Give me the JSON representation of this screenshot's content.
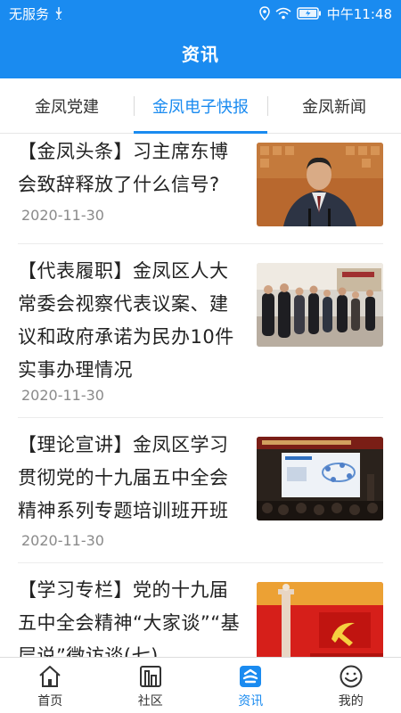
{
  "status_bar": {
    "carrier": "无服务",
    "usb_icon": "usb-icon",
    "location_icon": "location-icon",
    "wifi_icon": "wifi-icon",
    "battery_icon": "battery-charging-icon",
    "time": "中午11:48"
  },
  "header": {
    "title": "资讯"
  },
  "tabs": [
    {
      "label": "金凤党建"
    },
    {
      "label": "金凤电子快报"
    },
    {
      "label": "金凤新闻"
    }
  ],
  "active_tab": 1,
  "articles": [
    {
      "title": "【金凤头条】习主席东博会致辞释放了什么信号?",
      "date": "2020-11-30"
    },
    {
      "title": "【代表履职】金凤区人大常委会视察代表议案、建议和政府承诺为民办10件实事办理情况",
      "date": "2020-11-30"
    },
    {
      "title": "【理论宣讲】金凤区学习贯彻党的十九届五中全会精神系列专题培训班开班",
      "date": "2020-11-30"
    },
    {
      "title": "【学习专栏】党的十九届五中全会精神“大家谈”“基层说”微访谈(七)",
      "date": ""
    }
  ],
  "bottom_nav": [
    {
      "label": "首页",
      "icon": "home-icon"
    },
    {
      "label": "社区",
      "icon": "community-icon"
    },
    {
      "label": "资讯",
      "icon": "news-icon"
    },
    {
      "label": "我的",
      "icon": "profile-icon"
    }
  ],
  "active_nav": 2,
  "colors": {
    "accent": "#1a8bf0",
    "text": "#222222",
    "date": "#8a8a8a"
  }
}
